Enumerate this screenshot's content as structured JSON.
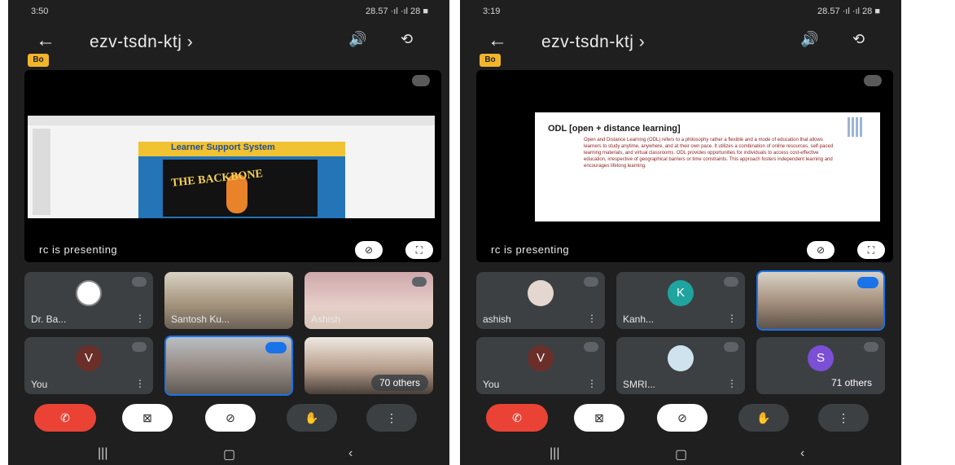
{
  "left": {
    "status_time": "3:50",
    "status_right": "28.57 ·ıl ·ıl 28 ■",
    "meeting_code": "ezv-tsdn-ktj ›",
    "badge": "Bo",
    "presenting": "rc is presenting",
    "slide": {
      "heading": "Learner Support System",
      "banner": "THE BACKBONE"
    },
    "tiles": [
      {
        "name": "Dr. Ba..."
      },
      {
        "name": "Santosh Ku..."
      },
      {
        "name": "Ashish"
      },
      {
        "name": "You",
        "avatar": "V"
      },
      {
        "name": ""
      },
      {
        "name": "",
        "others": "70 others"
      }
    ]
  },
  "right": {
    "status_time": "3:19",
    "status_right": "28.57 ·ıl ·ıl 28 ■",
    "meeting_code": "ezv-tsdn-ktj ›",
    "badge": "Bo",
    "presenting": "rc is presenting",
    "slide": {
      "heading": "ODL [open + distance learning]",
      "text": "Open and Distance Learning (ODL) refers to a philosophy rather a flexible and a mode of education that allows learners to study anytime, anywhere, and at their own pace. It utilizes a combination of online resources, self-paced learning materials, and virtual classrooms. ODL provides opportunities for individuals to access cost-effective education, irrespective of geographical barriers or time constraints. This approach fosters independent learning and encourages lifelong learning."
    },
    "tiles": [
      {
        "name": "ashish"
      },
      {
        "name": "Kanh...",
        "avatar": "K"
      },
      {
        "name": ""
      },
      {
        "name": "You",
        "avatar": "V"
      },
      {
        "name": "SMRI..."
      },
      {
        "name": "",
        "avatar": "S",
        "others": "71 others"
      }
    ]
  },
  "colors": {
    "background": "#1f1f1f",
    "end_call": "#ea4335",
    "tile": "#3c4043",
    "badge": "#f2b52a",
    "speaking": "#1a73e8",
    "avatar_you": "#6b2f2a",
    "avatar_k": "#1fa4a0",
    "avatar_s": "#7b4fd6"
  }
}
